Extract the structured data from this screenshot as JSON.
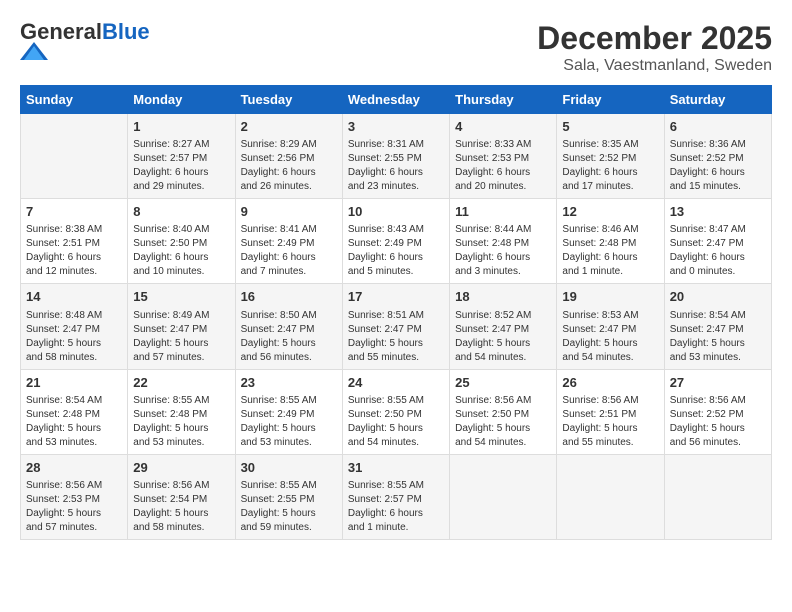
{
  "header": {
    "logo_general": "General",
    "logo_blue": "Blue",
    "month": "December 2025",
    "location": "Sala, Vaestmanland, Sweden"
  },
  "weekdays": [
    "Sunday",
    "Monday",
    "Tuesday",
    "Wednesday",
    "Thursday",
    "Friday",
    "Saturday"
  ],
  "weeks": [
    [
      {
        "day": "",
        "info": ""
      },
      {
        "day": "1",
        "info": "Sunrise: 8:27 AM\nSunset: 2:57 PM\nDaylight: 6 hours\nand 29 minutes."
      },
      {
        "day": "2",
        "info": "Sunrise: 8:29 AM\nSunset: 2:56 PM\nDaylight: 6 hours\nand 26 minutes."
      },
      {
        "day": "3",
        "info": "Sunrise: 8:31 AM\nSunset: 2:55 PM\nDaylight: 6 hours\nand 23 minutes."
      },
      {
        "day": "4",
        "info": "Sunrise: 8:33 AM\nSunset: 2:53 PM\nDaylight: 6 hours\nand 20 minutes."
      },
      {
        "day": "5",
        "info": "Sunrise: 8:35 AM\nSunset: 2:52 PM\nDaylight: 6 hours\nand 17 minutes."
      },
      {
        "day": "6",
        "info": "Sunrise: 8:36 AM\nSunset: 2:52 PM\nDaylight: 6 hours\nand 15 minutes."
      }
    ],
    [
      {
        "day": "7",
        "info": "Sunrise: 8:38 AM\nSunset: 2:51 PM\nDaylight: 6 hours\nand 12 minutes."
      },
      {
        "day": "8",
        "info": "Sunrise: 8:40 AM\nSunset: 2:50 PM\nDaylight: 6 hours\nand 10 minutes."
      },
      {
        "day": "9",
        "info": "Sunrise: 8:41 AM\nSunset: 2:49 PM\nDaylight: 6 hours\nand 7 minutes."
      },
      {
        "day": "10",
        "info": "Sunrise: 8:43 AM\nSunset: 2:49 PM\nDaylight: 6 hours\nand 5 minutes."
      },
      {
        "day": "11",
        "info": "Sunrise: 8:44 AM\nSunset: 2:48 PM\nDaylight: 6 hours\nand 3 minutes."
      },
      {
        "day": "12",
        "info": "Sunrise: 8:46 AM\nSunset: 2:48 PM\nDaylight: 6 hours\nand 1 minute."
      },
      {
        "day": "13",
        "info": "Sunrise: 8:47 AM\nSunset: 2:47 PM\nDaylight: 6 hours\nand 0 minutes."
      }
    ],
    [
      {
        "day": "14",
        "info": "Sunrise: 8:48 AM\nSunset: 2:47 PM\nDaylight: 5 hours\nand 58 minutes."
      },
      {
        "day": "15",
        "info": "Sunrise: 8:49 AM\nSunset: 2:47 PM\nDaylight: 5 hours\nand 57 minutes."
      },
      {
        "day": "16",
        "info": "Sunrise: 8:50 AM\nSunset: 2:47 PM\nDaylight: 5 hours\nand 56 minutes."
      },
      {
        "day": "17",
        "info": "Sunrise: 8:51 AM\nSunset: 2:47 PM\nDaylight: 5 hours\nand 55 minutes."
      },
      {
        "day": "18",
        "info": "Sunrise: 8:52 AM\nSunset: 2:47 PM\nDaylight: 5 hours\nand 54 minutes."
      },
      {
        "day": "19",
        "info": "Sunrise: 8:53 AM\nSunset: 2:47 PM\nDaylight: 5 hours\nand 54 minutes."
      },
      {
        "day": "20",
        "info": "Sunrise: 8:54 AM\nSunset: 2:47 PM\nDaylight: 5 hours\nand 53 minutes."
      }
    ],
    [
      {
        "day": "21",
        "info": "Sunrise: 8:54 AM\nSunset: 2:48 PM\nDaylight: 5 hours\nand 53 minutes."
      },
      {
        "day": "22",
        "info": "Sunrise: 8:55 AM\nSunset: 2:48 PM\nDaylight: 5 hours\nand 53 minutes."
      },
      {
        "day": "23",
        "info": "Sunrise: 8:55 AM\nSunset: 2:49 PM\nDaylight: 5 hours\nand 53 minutes."
      },
      {
        "day": "24",
        "info": "Sunrise: 8:55 AM\nSunset: 2:50 PM\nDaylight: 5 hours\nand 54 minutes."
      },
      {
        "day": "25",
        "info": "Sunrise: 8:56 AM\nSunset: 2:50 PM\nDaylight: 5 hours\nand 54 minutes."
      },
      {
        "day": "26",
        "info": "Sunrise: 8:56 AM\nSunset: 2:51 PM\nDaylight: 5 hours\nand 55 minutes."
      },
      {
        "day": "27",
        "info": "Sunrise: 8:56 AM\nSunset: 2:52 PM\nDaylight: 5 hours\nand 56 minutes."
      }
    ],
    [
      {
        "day": "28",
        "info": "Sunrise: 8:56 AM\nSunset: 2:53 PM\nDaylight: 5 hours\nand 57 minutes."
      },
      {
        "day": "29",
        "info": "Sunrise: 8:56 AM\nSunset: 2:54 PM\nDaylight: 5 hours\nand 58 minutes."
      },
      {
        "day": "30",
        "info": "Sunrise: 8:55 AM\nSunset: 2:55 PM\nDaylight: 5 hours\nand 59 minutes."
      },
      {
        "day": "31",
        "info": "Sunrise: 8:55 AM\nSunset: 2:57 PM\nDaylight: 6 hours\nand 1 minute."
      },
      {
        "day": "",
        "info": ""
      },
      {
        "day": "",
        "info": ""
      },
      {
        "day": "",
        "info": ""
      }
    ]
  ]
}
